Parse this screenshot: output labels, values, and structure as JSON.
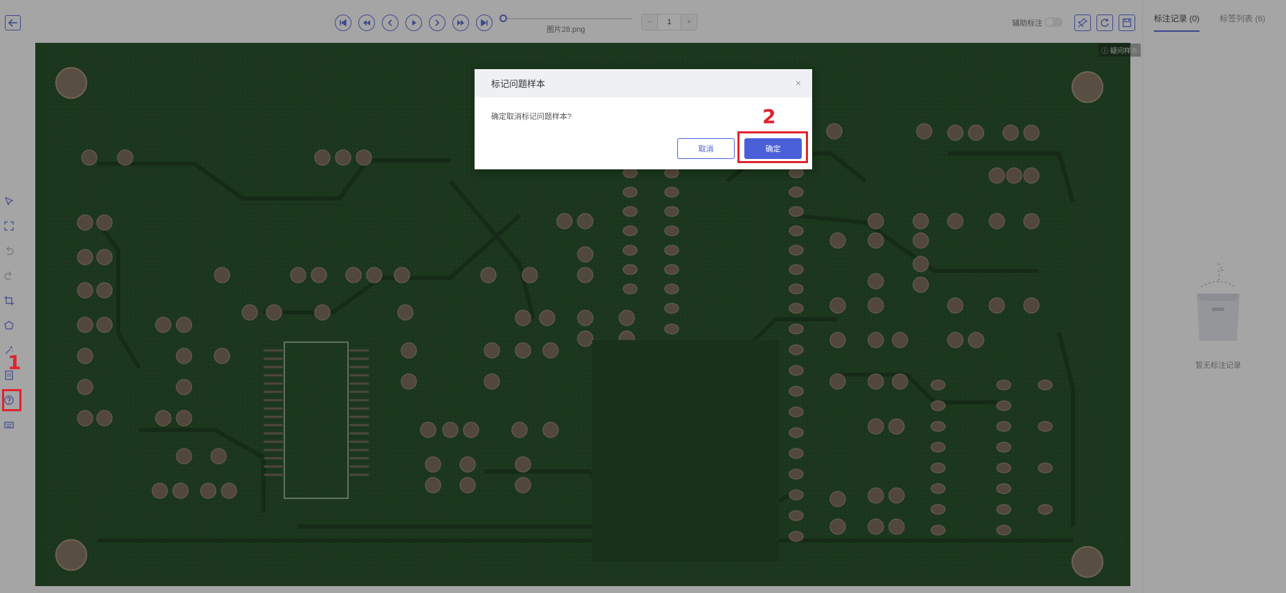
{
  "toolbar": {
    "filename": "图片28.png",
    "page_value": "1",
    "page_minus": "−",
    "page_plus": "+",
    "assist_label": "辅助标注"
  },
  "right_panel": {
    "tab_records": "标注记录 (0)",
    "tab_labels": "标签列表 (6)",
    "empty_text": "暂无标注记录"
  },
  "canvas": {
    "badge": "疑问样本"
  },
  "dialog": {
    "title": "标记问题样本",
    "close": "×",
    "message": "确定取消标记问题样本?",
    "cancel_label": "取消",
    "confirm_label": "确定"
  },
  "annotations": {
    "step1": "1",
    "step2": "2"
  },
  "colors": {
    "accent": "#4a60d8",
    "pcb": "#0e3410",
    "annotation_red": "#e0222f"
  }
}
